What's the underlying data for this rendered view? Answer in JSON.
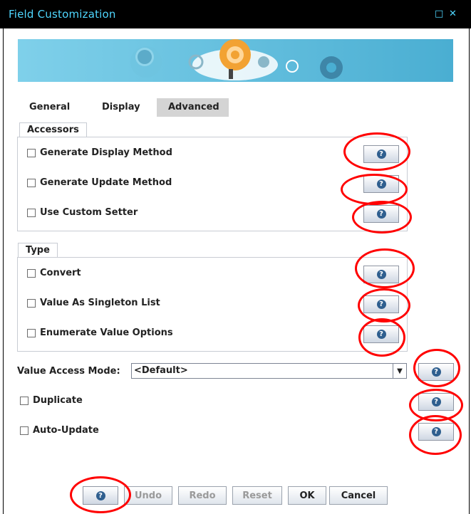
{
  "window": {
    "title": "Field Customization",
    "restore_glyph": "□",
    "close_glyph": "✕"
  },
  "tabs": [
    {
      "label": "General",
      "active": false
    },
    {
      "label": "Display",
      "active": false
    },
    {
      "label": "Advanced",
      "active": true
    }
  ],
  "accessors": {
    "legend": "Accessors",
    "items": [
      {
        "label": "Generate Display Method",
        "checked": false
      },
      {
        "label": "Generate Update Method",
        "checked": false
      },
      {
        "label": "Use Custom Setter",
        "checked": false
      }
    ]
  },
  "type_section": {
    "legend": "Type",
    "items": [
      {
        "label": "Convert",
        "checked": false
      },
      {
        "label": "Value As Singleton List",
        "checked": false
      },
      {
        "label": "Enumerate Value Options",
        "checked": false
      }
    ]
  },
  "value_access_mode": {
    "label": "Value Access Mode:",
    "selected": "<Default>"
  },
  "options": [
    {
      "label": "Duplicate",
      "checked": false
    },
    {
      "label": "Auto-Update",
      "checked": false
    }
  ],
  "help_glyph": "?",
  "footer": {
    "undo": "Undo",
    "redo": "Redo",
    "reset": "Reset",
    "ok": "OK",
    "cancel": "Cancel"
  },
  "colors": {
    "title_text": "#4fd7ff",
    "banner": "#56b7d8",
    "annotation": "#ff0000"
  }
}
